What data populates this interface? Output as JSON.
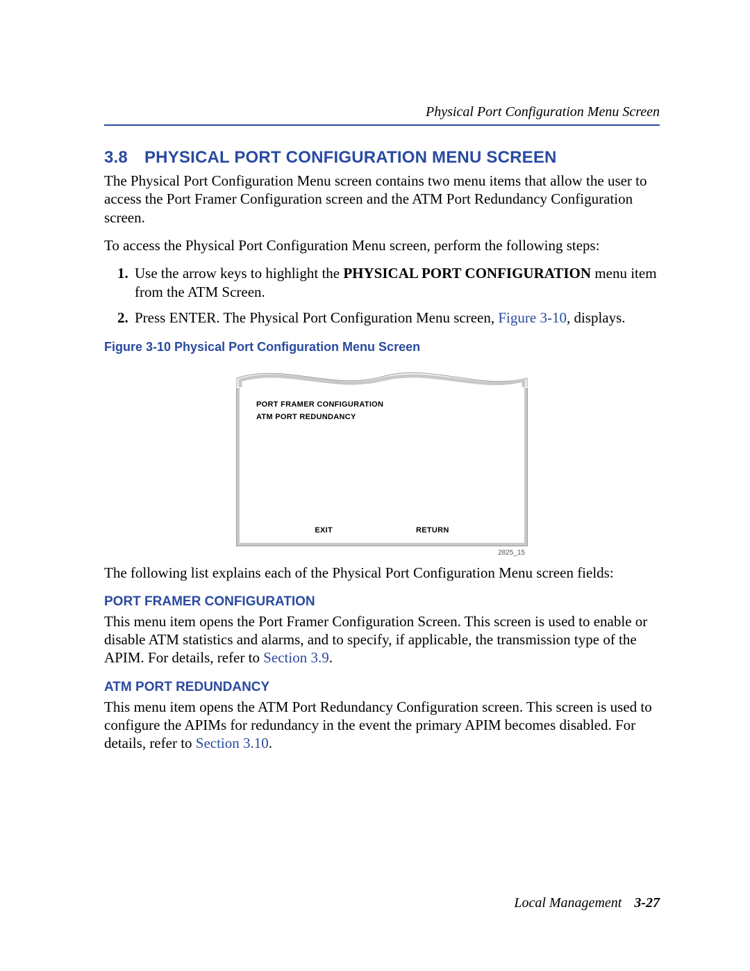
{
  "header": {
    "running_title": "Physical Port Configuration Menu Screen"
  },
  "section": {
    "number": "3.8",
    "title": "PHYSICAL PORT CONFIGURATION MENU SCREEN",
    "para1": "The Physical Port Configuration Menu screen contains two menu items that allow the user to access the Port Framer Configuration screen and the ATM Port Redundancy Configuration screen.",
    "para2": "To access the Physical Port Configuration Menu screen, perform the following steps:",
    "steps": {
      "s1_a": "Use the arrow keys to highlight the ",
      "s1_bold": "PHYSICAL PORT CONFIGURATION",
      "s1_b": " menu item from the ATM Screen.",
      "s2_a": "Press ENTER. The Physical Port Configuration Menu screen, ",
      "s2_link": "Figure 3-10",
      "s2_b": ", displays."
    },
    "figure": {
      "caption": "Figure 3-10    Physical Port Configuration Menu Screen",
      "menu_item1": "PORT FRAMER CONFIGURATION",
      "menu_item2": "ATM PORT REDUNDANCY",
      "footer_exit": "EXIT",
      "footer_return": "RETURN",
      "tag": "2825_15"
    },
    "after_figure": "The following list explains each of the Physical Port Configuration Menu screen fields:",
    "sub1": {
      "heading": "PORT FRAMER CONFIGURATION",
      "text_a": "This menu item opens the Port Framer Configuration Screen. This screen is used to enable or disable ATM statistics and alarms, and to specify, if applicable, the transmission type of the APIM. For details, refer to ",
      "link": "Section 3.9",
      "text_b": "."
    },
    "sub2": {
      "heading": "ATM PORT REDUNDANCY",
      "text_a": "This menu item opens the ATM Port Redundancy Configuration screen. This screen is used to configure the APIMs for redundancy in the event the primary APIM becomes disabled. For details, refer to ",
      "link": "Section 3.10",
      "text_b": "."
    }
  },
  "footer": {
    "doc_title": "Local Management",
    "page_no": "3-27"
  }
}
